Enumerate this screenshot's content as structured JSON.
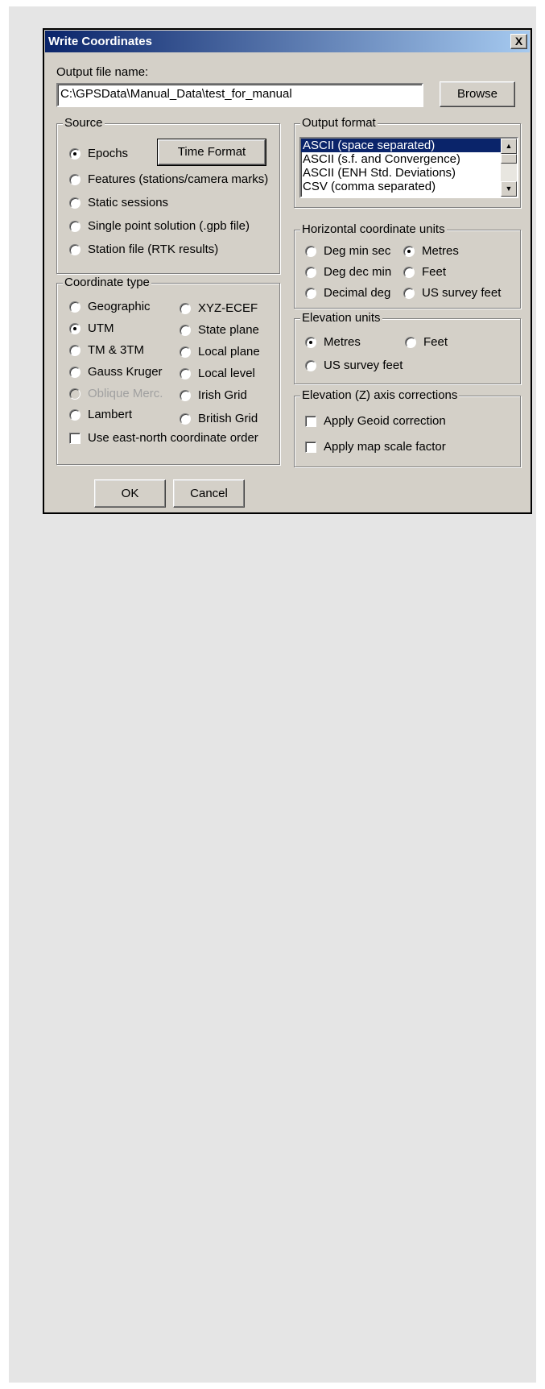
{
  "dialog": {
    "title": "Write Coordinates",
    "close_label": "X"
  },
  "output_file": {
    "label": "Output file name:",
    "value": "C:\\GPSData\\Manual_Data\\test_for_manual",
    "browse_label": "Browse"
  },
  "source": {
    "title": "Source",
    "time_format_label": "Time Format",
    "options": [
      {
        "label": "Epochs",
        "selected": true
      },
      {
        "label": "Features (stations/camera marks)",
        "selected": false
      },
      {
        "label": "Static sessions",
        "selected": false
      },
      {
        "label": "Single point solution (.gpb file)",
        "selected": false
      },
      {
        "label": "Station file (RTK results)",
        "selected": false
      }
    ]
  },
  "output_format": {
    "title": "Output format",
    "items": [
      {
        "label": "ASCII (space separated)",
        "selected": true
      },
      {
        "label": "ASCII (s.f. and Convergence)",
        "selected": false
      },
      {
        "label": "ASCII (ENH Std. Deviations)",
        "selected": false
      },
      {
        "label": "CSV (comma separated)",
        "selected": false
      }
    ]
  },
  "horizontal_units": {
    "title": "Horizontal coordinate units",
    "options": [
      {
        "label": "Deg min sec",
        "selected": false
      },
      {
        "label": "Metres",
        "selected": true
      },
      {
        "label": "Deg dec min",
        "selected": false
      },
      {
        "label": "Feet",
        "selected": false
      },
      {
        "label": "Decimal deg",
        "selected": false
      },
      {
        "label": "US survey feet",
        "selected": false
      }
    ]
  },
  "coordinate_type": {
    "title": "Coordinate type",
    "options": [
      {
        "label": "Geographic",
        "selected": false,
        "disabled": false
      },
      {
        "label": "XYZ-ECEF",
        "selected": false,
        "disabled": false
      },
      {
        "label": "UTM",
        "selected": true,
        "disabled": false
      },
      {
        "label": "State plane",
        "selected": false,
        "disabled": false
      },
      {
        "label": "TM & 3TM",
        "selected": false,
        "disabled": false
      },
      {
        "label": "Local plane",
        "selected": false,
        "disabled": false
      },
      {
        "label": "Gauss Kruger",
        "selected": false,
        "disabled": false
      },
      {
        "label": "Local level",
        "selected": false,
        "disabled": false
      },
      {
        "label": "Oblique Merc.",
        "selected": false,
        "disabled": true
      },
      {
        "label": "Irish Grid",
        "selected": false,
        "disabled": false
      },
      {
        "label": "Lambert",
        "selected": false,
        "disabled": false
      },
      {
        "label": "British Grid",
        "selected": false,
        "disabled": false
      }
    ],
    "east_north_label": "Use east-north coordinate order",
    "east_north_checked": false
  },
  "elevation_units": {
    "title": "Elevation units",
    "options": [
      {
        "label": "Metres",
        "selected": true
      },
      {
        "label": "Feet",
        "selected": false
      },
      {
        "label": "US survey feet",
        "selected": false
      }
    ]
  },
  "elevation_corrections": {
    "title": "Elevation (Z) axis corrections",
    "geoid_label": "Apply Geoid correction",
    "geoid_checked": false,
    "scale_label": "Apply map scale factor",
    "scale_checked": false
  },
  "footer": {
    "ok_label": "OK",
    "cancel_label": "Cancel"
  },
  "colors": {
    "dialog_face": "#d4d0c8",
    "titlebar_start": "#0a246a",
    "titlebar_end": "#a6caf0",
    "selection": "#0a246a",
    "page_background": "#e5e5e5"
  }
}
